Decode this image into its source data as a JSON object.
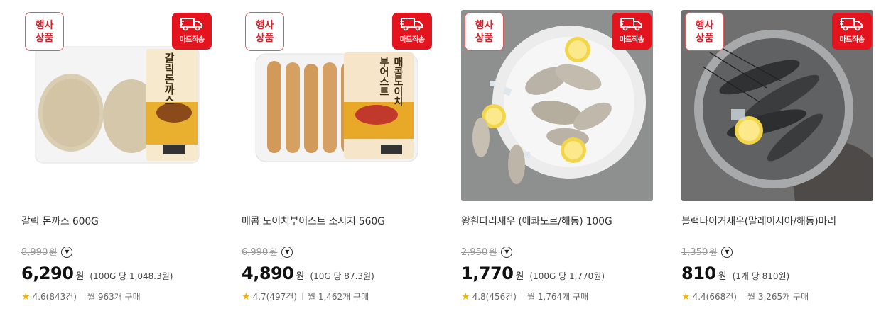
{
  "products": [
    {
      "promo_badge": [
        "행사",
        "상품"
      ],
      "delivery_badge": "마트직송",
      "title": "갈릭 돈까스 600G",
      "original_price": "8,990",
      "original_unit": "원",
      "price": "6,290",
      "price_unit": "원",
      "unit_price": "(100G 당 1,048.3원)",
      "rating": "4.6",
      "reviews": "(843건)",
      "monthly": "월 963개 구매",
      "package_text": "갈릭돈까스"
    },
    {
      "promo_badge": [
        "행사",
        "상품"
      ],
      "delivery_badge": "마트직송",
      "title": "매콤 도이치부어스트 소시지 560G",
      "original_price": "6,990",
      "original_unit": "원",
      "price": "4,890",
      "price_unit": "원",
      "unit_price": "(10G 당 87.3원)",
      "rating": "4.7",
      "reviews": "(497건)",
      "monthly": "월 1,462개 구매",
      "package_text": "매콤도이치부어스트"
    },
    {
      "promo_badge": [
        "행사",
        "상품"
      ],
      "delivery_badge": "마트직송",
      "title": "왕흰다리새우 (에콰도르/해동) 100G",
      "original_price": "2,950",
      "original_unit": "원",
      "price": "1,770",
      "price_unit": "원",
      "unit_price": "(100G 당 1,770원)",
      "rating": "4.8",
      "reviews": "(456건)",
      "monthly": "월 1,764개 구매"
    },
    {
      "promo_badge": [
        "행사",
        "상품"
      ],
      "delivery_badge": "마트직송",
      "title": "블랙타이거새우(말레이시아/해동)마리",
      "original_price": "1,350",
      "original_unit": "원",
      "price": "810",
      "price_unit": "원",
      "unit_price": "(1개 당 810원)",
      "rating": "4.4",
      "reviews": "(668건)",
      "monthly": "월 3,265개 구매"
    }
  ],
  "colors": {
    "badge_red": "#e4141e",
    "promo_text": "#d8202a",
    "star": "#f5b301"
  },
  "icons": {
    "delivery": "truck-icon",
    "star": "star-icon",
    "dropdown": "chevron-down-icon"
  }
}
